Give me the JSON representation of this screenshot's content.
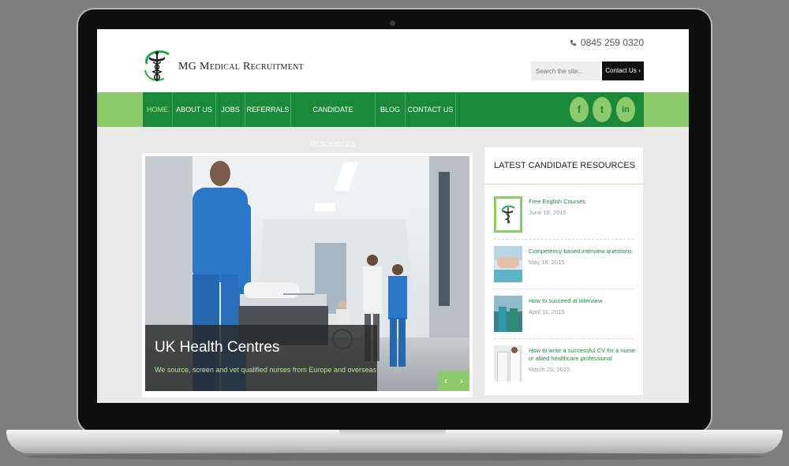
{
  "site": {
    "brand": "MG Medical Recruitment",
    "phone": "0845 259 0320",
    "search_placeholder": "Search the site...",
    "contact_button": "Contact Us"
  },
  "nav": [
    {
      "label": "HOME",
      "active": true
    },
    {
      "label": "ABOUT US"
    },
    {
      "label": "JOBS"
    },
    {
      "label": "REFERRALS"
    },
    {
      "label": "CANDIDATE RESOURCES"
    },
    {
      "label": "BLOG"
    },
    {
      "label": "CONTACT US"
    }
  ],
  "social": [
    {
      "icon": "facebook-icon",
      "glyph": "f"
    },
    {
      "icon": "twitter-icon",
      "glyph": "t"
    },
    {
      "icon": "linkedin-icon",
      "glyph": "in"
    }
  ],
  "slider": {
    "title": "UK Health Centres",
    "subtitle": "We source, screen and vet qualified nurses from Europe and overseas",
    "prev": "‹",
    "next": "›"
  },
  "sidebar": {
    "heading": "LATEST CANDIDATE RESOURCES",
    "items": [
      {
        "title": "Free English Courses",
        "date": "June 18, 2015"
      },
      {
        "title": "Competency-based interview questions",
        "date": "May 18, 2015"
      },
      {
        "title": "How to succeed at interview",
        "date": "April 11, 2015"
      },
      {
        "title": "How to write a successful CV for a nurse or allied healthcare professional",
        "date": "March 26, 2015"
      }
    ]
  },
  "colors": {
    "nav_green": "#1a8a3a",
    "light_green": "#8ec96b",
    "accent_text": "#b6e58c"
  }
}
